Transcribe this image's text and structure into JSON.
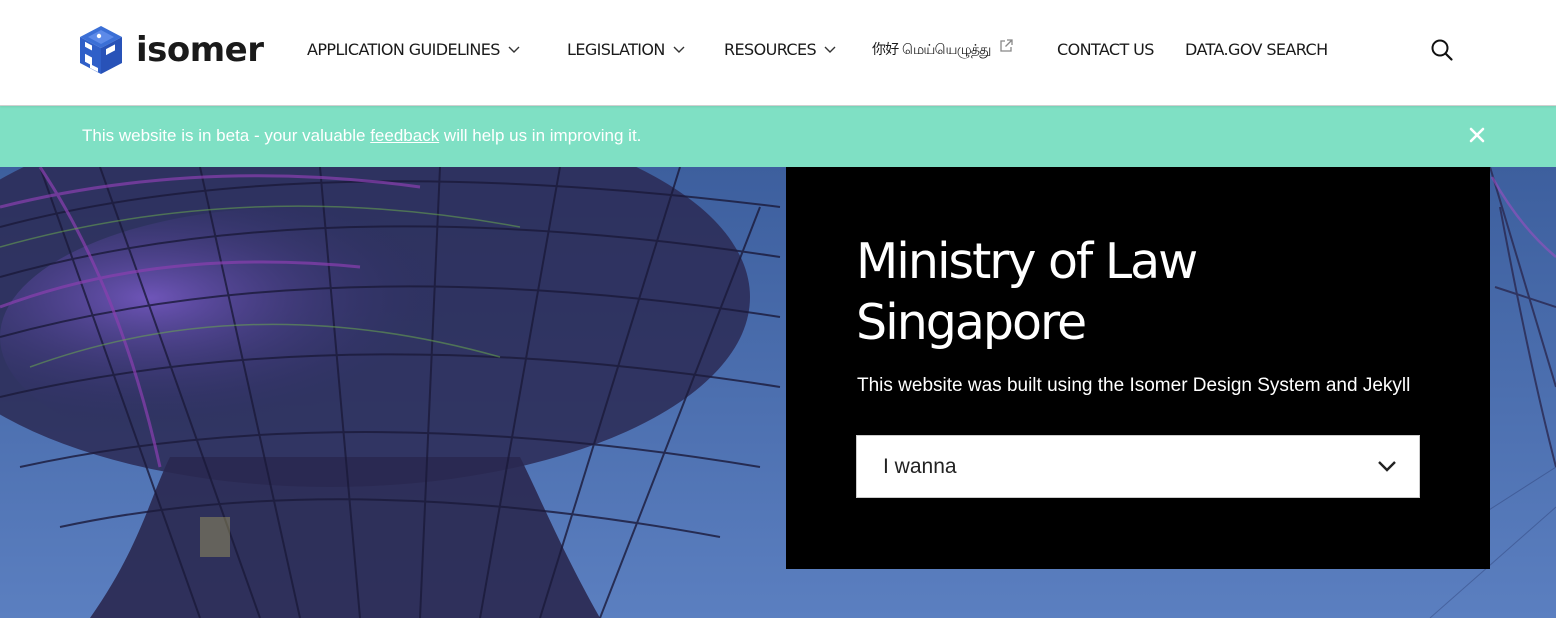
{
  "header": {
    "logo_text": "isomer",
    "nav": [
      {
        "label": "APPLICATION GUIDELINES",
        "icon": "chevron-down-icon"
      },
      {
        "label": "LEGISLATION",
        "icon": "chevron-down-icon"
      },
      {
        "label": "RESOURCES",
        "icon": "chevron-down-icon"
      },
      {
        "label": "你好 மெய்யெழுத்து",
        "icon": "external-link-icon"
      },
      {
        "label": "CONTACT US"
      },
      {
        "label": "DATA.GOV SEARCH"
      }
    ],
    "search_icon": "search-icon"
  },
  "banner": {
    "text_before": "This website is in beta - your valuable ",
    "link": "feedback",
    "text_after": " will help us in improving it.",
    "close_icon": "close-icon",
    "background": "#7fe0c4"
  },
  "hero": {
    "title_line1": "Ministry of Law",
    "title_line2": "Singapore",
    "subtitle": "This website was built using the Isomer Design System and Jekyll",
    "dropdown_label": "I wanna",
    "dropdown_icon": "chevron-down-icon",
    "card_background": "#000000"
  },
  "colors": {
    "brand_blue": "#2f5fd0",
    "banner_green": "#7fe0c4"
  }
}
